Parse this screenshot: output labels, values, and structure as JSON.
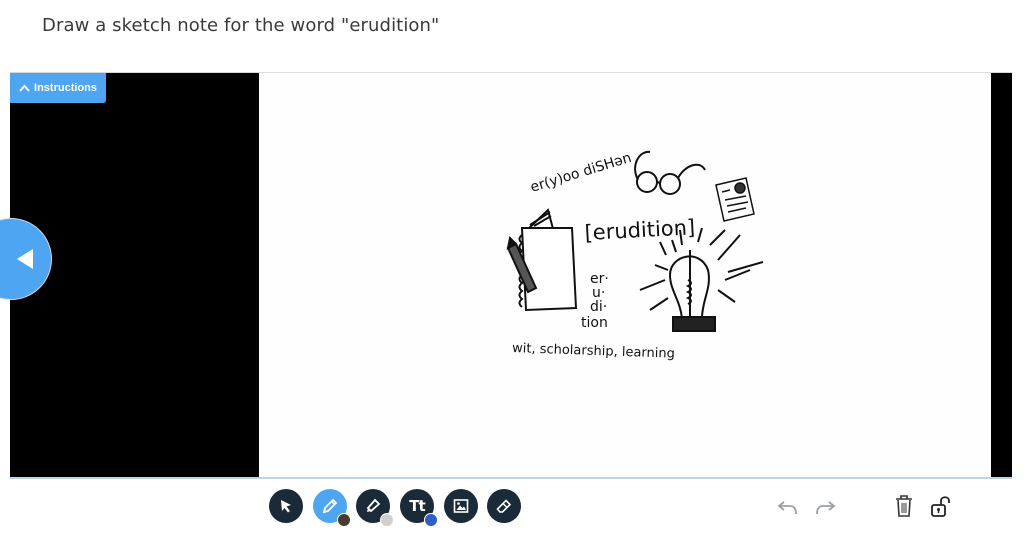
{
  "prompt": {
    "text": "Draw a sketch note for the word \"erudition\""
  },
  "stage": {
    "instructions_label": "Instructions",
    "prev_button": "previous",
    "sketch": {
      "pronunciation": "er(y)oo diSHən",
      "word": "[erudition]",
      "syllables": [
        "er·",
        "u·",
        "di·",
        "tion"
      ],
      "definition": "wit, scholarship, learning"
    }
  },
  "toolbar": {
    "tools": [
      {
        "id": "select",
        "icon": "cursor-icon",
        "active": false
      },
      {
        "id": "pen",
        "icon": "pencil-icon",
        "active": true,
        "color": "#4a3a33"
      },
      {
        "id": "highlighter",
        "icon": "highlighter-icon",
        "active": false,
        "color": "#cfcfcf"
      },
      {
        "id": "text",
        "icon": "text-icon",
        "label": "Tt",
        "active": false,
        "color": "#2f5fc4"
      },
      {
        "id": "image",
        "icon": "image-icon",
        "active": false
      },
      {
        "id": "eraser",
        "icon": "eraser-icon",
        "active": false
      }
    ],
    "actions": [
      {
        "id": "undo",
        "icon": "undo-icon"
      },
      {
        "id": "redo",
        "icon": "redo-icon"
      },
      {
        "id": "delete",
        "icon": "trash-icon"
      },
      {
        "id": "lock",
        "icon": "unlock-icon"
      }
    ]
  },
  "colors": {
    "accent": "#4ea6f2",
    "tool_dark": "#1b2a38"
  }
}
